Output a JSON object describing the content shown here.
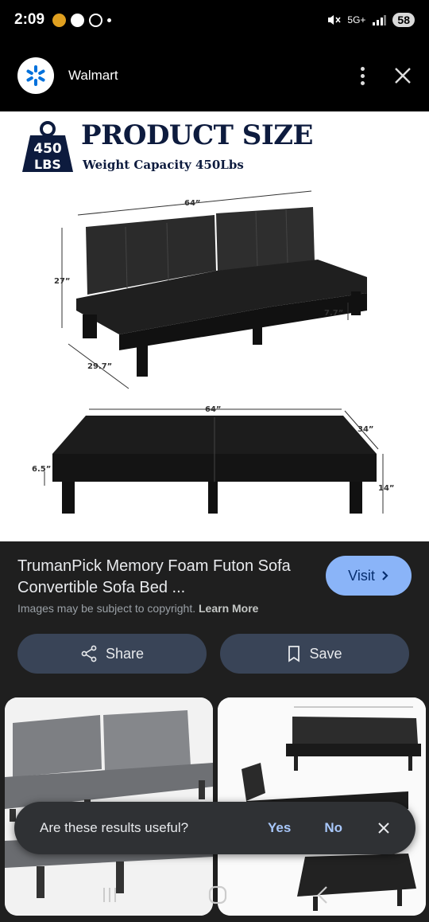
{
  "status": {
    "time": "2:09",
    "network": "5G+",
    "battery": "58"
  },
  "appbar": {
    "site_name": "Walmart"
  },
  "image": {
    "badge_top": "450",
    "badge_bottom": "LBS",
    "title": "PRODUCT SIZE",
    "subtitle": "Weight Capacity 450Lbs",
    "dims_top": {
      "width": "64”",
      "height": "27”",
      "depth": "29.7”",
      "leg": "7.7”"
    },
    "dims_bottom": {
      "width": "64”",
      "depth": "34”",
      "height": "14”",
      "leg": "6.5”"
    }
  },
  "result": {
    "title": "TrumanPick Memory Foam Futon Sofa Convertible Sofa Bed ...",
    "visit_label": "Visit",
    "copyright_text": "Images may be subject to copyright.",
    "learn_more": "Learn More",
    "share_label": "Share",
    "save_label": "Save"
  },
  "toast": {
    "question": "Are these results useful?",
    "yes": "Yes",
    "no": "No"
  },
  "colors": {
    "walmart_blue": "#0071dc",
    "spark_yellow": "#ffc220",
    "visit_bg": "#8ab4f8",
    "pill_bg": "#394457"
  },
  "icons": [
    "walmart-spark-icon",
    "more-vert-icon",
    "close-icon",
    "lens-search-icon",
    "chevron-right-icon",
    "share-icon",
    "bookmark-icon",
    "weight-icon"
  ]
}
